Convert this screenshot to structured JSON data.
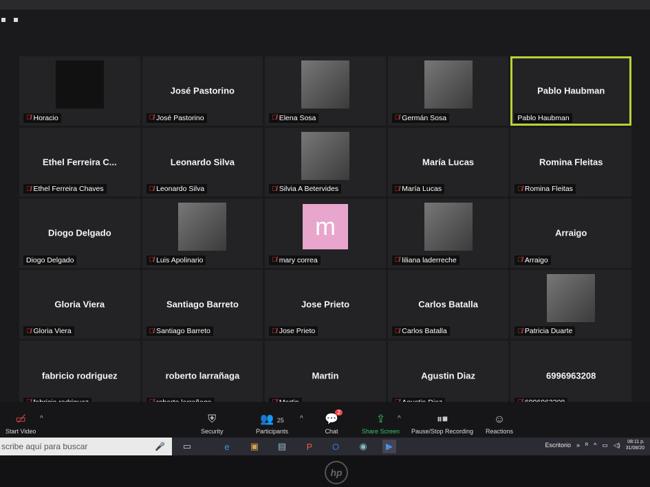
{
  "participants": [
    {
      "center": "",
      "label": "Horacio",
      "muted": true,
      "media": "video-dark"
    },
    {
      "center": "José Pastorino",
      "label": "José Pastorino",
      "muted": true,
      "media": "none"
    },
    {
      "center": "",
      "label": "Elena Sosa",
      "muted": true,
      "media": "photo"
    },
    {
      "center": "",
      "label": "Germán Sosa",
      "muted": true,
      "media": "photo"
    },
    {
      "center": "Pablo Haubman",
      "label": "Pablo Haubman",
      "muted": false,
      "media": "none",
      "active": true
    },
    {
      "center": "Ethel Ferreira C...",
      "label": "Ethel Ferreira Chaves",
      "muted": true,
      "media": "none"
    },
    {
      "center": "Leonardo Silva",
      "label": "Leonardo Silva",
      "muted": true,
      "media": "none"
    },
    {
      "center": "",
      "label": "Silvia A Betervides",
      "muted": true,
      "media": "photo"
    },
    {
      "center": "María Lucas",
      "label": "María Lucas",
      "muted": true,
      "media": "none"
    },
    {
      "center": "Romina Fleitas",
      "label": "Romina Fleitas",
      "muted": true,
      "media": "none"
    },
    {
      "center": "Diogo Delgado",
      "label": "Diogo Delgado",
      "muted": false,
      "media": "none"
    },
    {
      "center": "",
      "label": "Luis Apolinario",
      "muted": true,
      "media": "photo"
    },
    {
      "center": "",
      "label": "mary correa",
      "muted": true,
      "media": "avatar",
      "avatar_letter": "m"
    },
    {
      "center": "",
      "label": "liliana laderreche",
      "muted": true,
      "media": "photo"
    },
    {
      "center": "Arraigo",
      "label": "Arraigo",
      "muted": true,
      "media": "none"
    },
    {
      "center": "Gloria Viera",
      "label": "Gloria Viera",
      "muted": true,
      "media": "none"
    },
    {
      "center": "Santiago Barreto",
      "label": "Santiago Barreto",
      "muted": true,
      "media": "none"
    },
    {
      "center": "Jose Prieto",
      "label": "Jose Prieto",
      "muted": true,
      "media": "none"
    },
    {
      "center": "Carlos Batalla",
      "label": "Carlos Batalla",
      "muted": true,
      "media": "none"
    },
    {
      "center": "",
      "label": "Patricia Duarte",
      "muted": true,
      "media": "photo"
    },
    {
      "center": "fabricio rodriguez",
      "label": "fabricio rodriguez",
      "muted": true,
      "media": "none"
    },
    {
      "center": "roberto larrañaga",
      "label": "roberto larrañaga",
      "muted": true,
      "media": "none"
    },
    {
      "center": "Martin",
      "label": "Martin",
      "muted": true,
      "media": "none"
    },
    {
      "center": "Agustin Diaz",
      "label": "Agustin Diaz",
      "muted": true,
      "media": "none"
    },
    {
      "center": "6996963208",
      "label": "6996963208",
      "muted": true,
      "media": "none"
    }
  ],
  "toolbar": {
    "start_video": "Start Video",
    "security": "Security",
    "participants": "Participants",
    "participants_count": "25",
    "chat": "Chat",
    "chat_badge": "2",
    "share_screen": "Share Screen",
    "recording": "Pause/Stop Recording",
    "reactions": "Reactions"
  },
  "taskbar": {
    "search_placeholder": "scribe aquí para buscar",
    "desktop_label": "Escritorio",
    "time": "08:11 p.",
    "date": "31/08/20"
  },
  "brand": "hp",
  "colors": {
    "active_speaker": "#b7d337",
    "share_green": "#3bc16f",
    "mute_red": "#e54848",
    "avatar_pink": "#e8a6cc"
  }
}
